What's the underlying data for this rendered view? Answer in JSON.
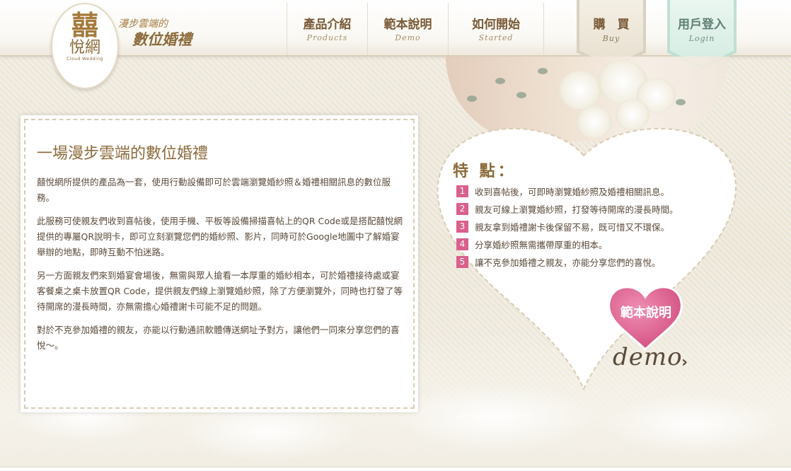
{
  "header": {
    "logo": {
      "glyph": "囍",
      "name": "悅網",
      "sub": "Cloud Wedding"
    },
    "tagline_line1": "漫步雲端的",
    "tagline_line2": "數位婚禮",
    "nav": [
      {
        "zh": "產品介紹",
        "en": "Products"
      },
      {
        "zh": "範本說明",
        "en": "Demo"
      },
      {
        "zh": "如何開始",
        "en": "Started"
      }
    ],
    "buy": {
      "zh": "購　買",
      "en": "Buy"
    },
    "login": {
      "zh": "用戶登入",
      "en": "Login"
    }
  },
  "content": {
    "title": "一場漫步雲端的數位婚禮",
    "paragraphs": [
      "囍悅網所提供的產品為一套，使用行動設備即可於雲端瀏覽婚紗照＆婚禮相關訊息的數位服務。",
      "此服務可使親友們收到喜帖後，使用手機、平板等設備掃描喜帖上的QR Code或是搭配囍悅網提供的專屬QR說明卡，即可立刻瀏覽您們的婚紗照、影片，同時可於Google地圖中了解婚宴舉辦的地點，即時互動不怕迷路。",
      "另一方面親友們來到婚宴會場後，無需與眾人搶看一本厚重的婚紗相本，可於婚禮接待處或宴客餐桌之桌卡放置QR Code，提供親友們線上瀏覽婚紗照，除了方便瀏覽外，同時也打發了等待開席的漫長時間，亦無需擔心婚禮謝卡可能不足的問題。",
      "對於不克參加婚禮的親友，亦能以行動通訊軟體傳送網址予對方，讓他們一同來分享您們的喜悅～。"
    ]
  },
  "features": {
    "title": "特 點：",
    "items": [
      {
        "num": "1",
        "text": "收到喜帖後，可即時瀏覽婚紗照及婚禮相關訊息。"
      },
      {
        "num": "2",
        "text": "親友可線上瀏覽婚紗照，打發等待開席的漫長時間。"
      },
      {
        "num": "3",
        "text": "親友拿到婚禮謝卡後保留不易，既可惜又不環保。"
      },
      {
        "num": "4",
        "text": "分享婚紗照無需攜帶厚重的相本。"
      },
      {
        "num": "5",
        "text": "讓不克參加婚禮之親友，亦能分享您們的喜悅。"
      }
    ]
  },
  "demo": {
    "label": "範本說明",
    "word": "demo",
    "arrow": "›"
  },
  "colors": {
    "accent_pink": "#d9608c",
    "brown": "#8c6a3a",
    "login_tab": "#bfe0d3",
    "buy_tab": "#d9d2c1"
  }
}
